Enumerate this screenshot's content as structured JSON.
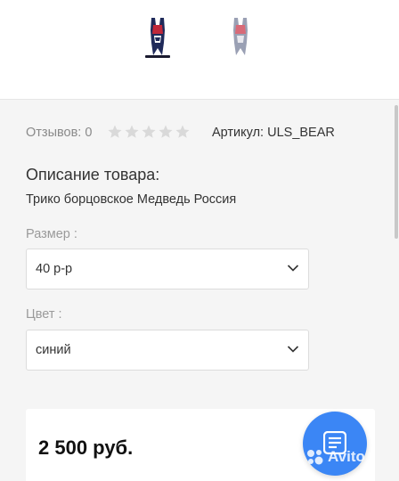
{
  "gallery": {
    "thumbnails": [
      {
        "name": "product-thumbnail-1",
        "selected": true
      },
      {
        "name": "product-thumbnail-2",
        "selected": false
      }
    ]
  },
  "product": {
    "reviews_label": "Отзывов: 0",
    "rating": 0,
    "rating_max": 5,
    "sku_label": "Артикул: ULS_BEAR",
    "description_heading": "Описание товара:",
    "description_text": "Трико борцовское Медведь Россия",
    "size_label": "Размер :",
    "size_value": "40 р-р",
    "color_label": "Цвет :",
    "color_value": "синий",
    "price": "2 500 руб."
  },
  "watermark": {
    "text": "Avito"
  },
  "colors": {
    "accent": "#3b86f5",
    "star_empty": "#d9d9d9",
    "background": "#f5f5f5"
  }
}
